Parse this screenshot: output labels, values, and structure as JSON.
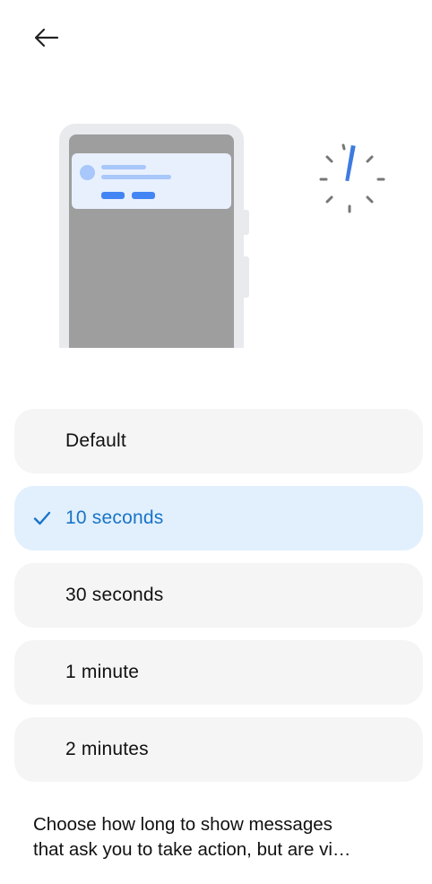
{
  "header": {
    "back_icon": "arrow-left-icon"
  },
  "illustration": {
    "phone_icon": "phone-notification-illustration",
    "timer_icon": "timer-icon",
    "accent_color": "#4285f4"
  },
  "options": [
    {
      "label": "Default",
      "selected": false
    },
    {
      "label": "10 seconds",
      "selected": true
    },
    {
      "label": "30 seconds",
      "selected": false
    },
    {
      "label": "1 minute",
      "selected": false
    },
    {
      "label": "2 minutes",
      "selected": false
    }
  ],
  "description": {
    "line1": "Choose how long to show messages",
    "line2": "that ask you to take action, but are vi…"
  },
  "colors": {
    "selected_bg": "#e1f0fc",
    "selected_text": "#1a73c8",
    "option_bg": "#f5f5f5"
  }
}
